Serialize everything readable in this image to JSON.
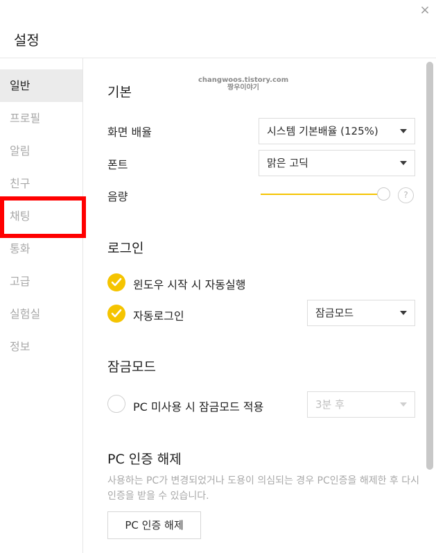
{
  "window": {
    "title": "설정",
    "close_icon": "×"
  },
  "sidebar": {
    "items": [
      {
        "label": "일반"
      },
      {
        "label": "프로필"
      },
      {
        "label": "알림"
      },
      {
        "label": "친구"
      },
      {
        "label": "채팅"
      },
      {
        "label": "통화"
      },
      {
        "label": "고급"
      },
      {
        "label": "실험실"
      },
      {
        "label": "정보"
      }
    ],
    "active_index": 0
  },
  "watermark": {
    "line1": "changwoos.tistory.com",
    "line2": "짱우이야기"
  },
  "sections": {
    "basic": {
      "heading": "기본",
      "scale_label": "화면 배율",
      "scale_value": "시스템 기본배율 (125%)",
      "font_label": "폰트",
      "font_value": "맑은 고딕",
      "volume_label": "음량",
      "volume_level": 1.0,
      "help_icon": "?"
    },
    "login": {
      "heading": "로그인",
      "autostart_label": "윈도우 시작 시 자동실행",
      "autostart_checked": true,
      "autologin_label": "자동로그인",
      "autologin_checked": true,
      "autologin_mode": "잠금모드"
    },
    "lock": {
      "heading": "잠금모드",
      "idle_label": "PC 미사용 시 잠금모드 적용",
      "idle_checked": false,
      "idle_time": "3분 후"
    },
    "pc_auth": {
      "heading": "PC 인증 해제",
      "description": "사용하는 PC가 변경되었거나 도용이 의심되는 경우 PC인증을 해제한 후 다시 인증을 받을 수 있습니다.",
      "button_label": "PC 인증 해제"
    }
  },
  "colors": {
    "accent": "#f5c400",
    "highlight": "#ff0000",
    "muted": "#a8a8a8"
  }
}
